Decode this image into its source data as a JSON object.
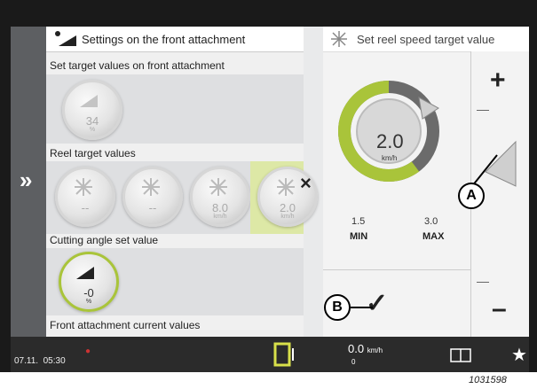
{
  "left_panel": {
    "title": "Settings on the front attachment",
    "section1": {
      "label": "Set target values on front attachment",
      "dial_value": "34",
      "dial_unit": "%"
    },
    "section2": {
      "label": "Reel target values",
      "dials": [
        {
          "value": "--"
        },
        {
          "value": "--"
        },
        {
          "value": "8.0",
          "unit": "km/h"
        },
        {
          "value": "2.0",
          "unit": "km/h"
        }
      ]
    },
    "section3": {
      "label": "Cutting angle set value",
      "dial_value": "-0",
      "dial_unit": "%"
    },
    "section4": {
      "label": "Front attachment current values"
    }
  },
  "right_panel": {
    "title": "Set reel speed target value",
    "gauge": {
      "value": "2.0",
      "unit": "km/h",
      "min_value": "1.5",
      "max_value": "3.0",
      "min_label": "MIN",
      "max_label": "MAX",
      "fill_fraction": 0.33
    },
    "plus_label": "+",
    "minus_label": "–",
    "confirm": "✓"
  },
  "controls": {
    "expand": "»",
    "close": "×"
  },
  "status_bar": {
    "date": "07.11.",
    "time": "05:30",
    "speed": "0.0",
    "speed_unit": "km/h",
    "speed_sub": "0"
  },
  "callouts": {
    "a": "A",
    "b": "B"
  },
  "figure_ref": "1031598",
  "colors": {
    "accent_green": "#a9c43a",
    "panel_bg": "#e9eaeb",
    "status_bg": "#2b2b2b"
  }
}
